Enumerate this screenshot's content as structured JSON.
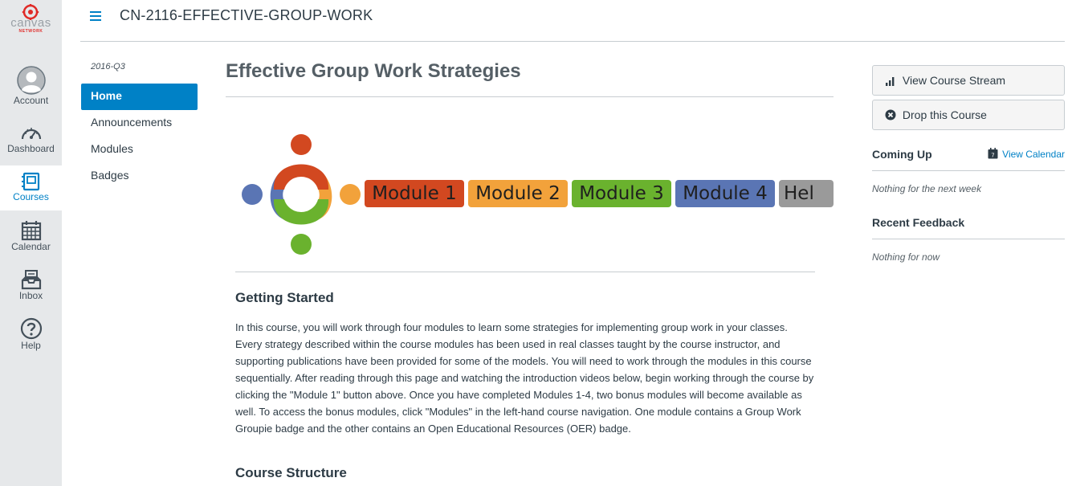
{
  "global_nav": {
    "logo_text": "canvas",
    "logo_sub": "NETWORK",
    "items": [
      {
        "label": "Account",
        "icon": "avatar-icon"
      },
      {
        "label": "Dashboard",
        "icon": "dashboard-icon"
      },
      {
        "label": "Courses",
        "icon": "courses-icon",
        "active": true
      },
      {
        "label": "Calendar",
        "icon": "calendar-icon"
      },
      {
        "label": "Inbox",
        "icon": "inbox-icon"
      },
      {
        "label": "Help",
        "icon": "help-icon"
      }
    ]
  },
  "header": {
    "course_title": "CN-2116-EFFECTIVE-GROUP-WORK"
  },
  "course_nav": {
    "term": "2016-Q3",
    "items": [
      {
        "label": "Home",
        "active": true
      },
      {
        "label": "Announcements"
      },
      {
        "label": "Modules"
      },
      {
        "label": "Badges"
      }
    ]
  },
  "main": {
    "page_title": "Effective Group Work Strategies",
    "banner": {
      "buttons": [
        "Module 1",
        "Module 2",
        "Module 3",
        "Module 4",
        "Hel"
      ]
    },
    "getting_started_heading": "Getting Started",
    "getting_started_text": "In this course, you will work through four modules to learn some strategies for implementing group work in your classes. Every strategy described within the course modules has been used in real classes taught by the course instructor, and supporting publications have been provided for some of the models. You will need to work through the modules in this course sequentially. After reading through this page and watching the introduction videos below, begin working through the course by clicking the \"Module 1\" button above. Once you have completed Modules 1-4, two bonus modules will become available as well. To access the bonus modules, click \"Modules\" in the left-hand course navigation. One module contains a Group Work Groupie badge and the other contains an Open Educational Resources (OER) badge.",
    "course_structure_heading": "Course Structure"
  },
  "aside": {
    "view_stream_label": "View Course Stream",
    "drop_course_label": "Drop this Course",
    "coming_up_heading": "Coming Up",
    "view_calendar_label": "View Calendar",
    "coming_up_empty": "Nothing for the next week",
    "recent_feedback_heading": "Recent Feedback",
    "recent_feedback_empty": "Nothing for now"
  },
  "colors": {
    "accent": "#0081c6",
    "nav_bg": "#e6e8ea",
    "module1": "#d24820",
    "module2": "#f2a23b",
    "module3": "#6ab22e",
    "module4": "#5a75b4",
    "module5": "#9a9a9a"
  }
}
